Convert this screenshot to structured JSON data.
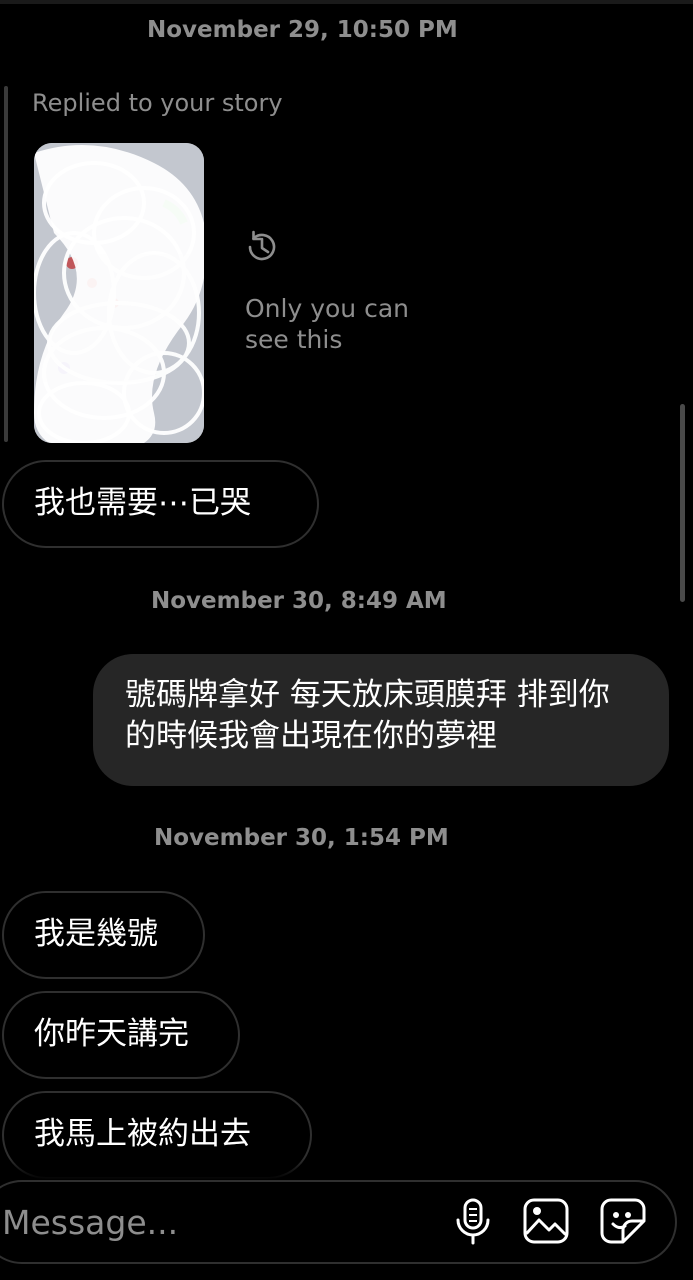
{
  "thread": {
    "timestamps": [
      "November 29, 10:50 PM",
      "November 30, 8:49 AM",
      "November 30, 1:54 PM"
    ],
    "story_reply": {
      "label": "Replied to your story",
      "hidden_notice": "Only you can see this",
      "icon": "history-icon"
    },
    "messages": [
      {
        "from": "them",
        "text": "我也需要⋯已哭"
      },
      {
        "from": "me",
        "text": "號碼牌拿好 每天放床頭膜拜 排到你的時候我會出現在你的夢裡"
      },
      {
        "from": "them",
        "text": "我是幾號"
      },
      {
        "from": "them",
        "text": "你昨天講完"
      },
      {
        "from": "them",
        "text": "我馬上被約出去"
      }
    ]
  },
  "composer": {
    "placeholder": "Message...",
    "icons": [
      "microphone-icon",
      "image-icon",
      "sticker-icon"
    ]
  },
  "colors": {
    "background": "#000000",
    "incoming_bubble_border": "#2f2f2f",
    "outgoing_bubble": "#262626",
    "muted_text": "#8e8e8e"
  }
}
